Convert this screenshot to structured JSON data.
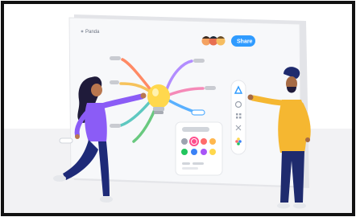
{
  "board": {
    "tab_label": "Panda",
    "share_label": "Share"
  },
  "colors": {
    "share_button": "#2f9bff",
    "board": "#f6f7f9",
    "floor": "#f1f1f3",
    "woman_top": "#8b5cf6",
    "woman_pants": "#1e2a78",
    "man_shirt": "#f5b731",
    "man_pants": "#1f2b6e"
  },
  "icons": [
    "hand-pointer-icon",
    "emoji-icon",
    "grid-icon",
    "network-icon",
    "flower-icon",
    "lightbulb-icon"
  ]
}
